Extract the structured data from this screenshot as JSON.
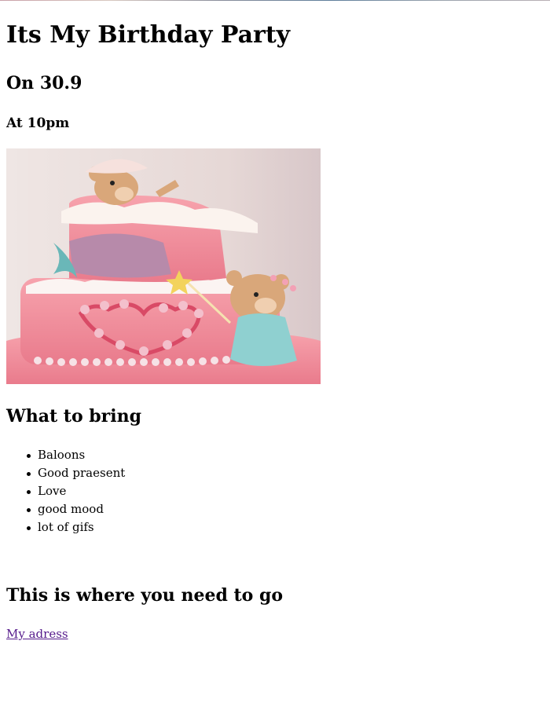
{
  "page": {
    "title": "Its My Birthday Party",
    "date": "On 30.9",
    "time": "At 10pm"
  },
  "image": {
    "icon": "birthday-cake-image",
    "colors": {
      "cake": "#f08a9a",
      "background": "#e9dfdf",
      "bear": "#d9a77a"
    }
  },
  "bring": {
    "heading": "What to bring",
    "items": [
      "Baloons",
      "Good praesent",
      "Love",
      "good mood",
      "lot of gifs"
    ]
  },
  "location": {
    "heading": "This is where you need to go",
    "link_text": "My adress"
  },
  "colors": {
    "link_visited": "#551a8b",
    "text": "#000000",
    "background": "#ffffff"
  }
}
